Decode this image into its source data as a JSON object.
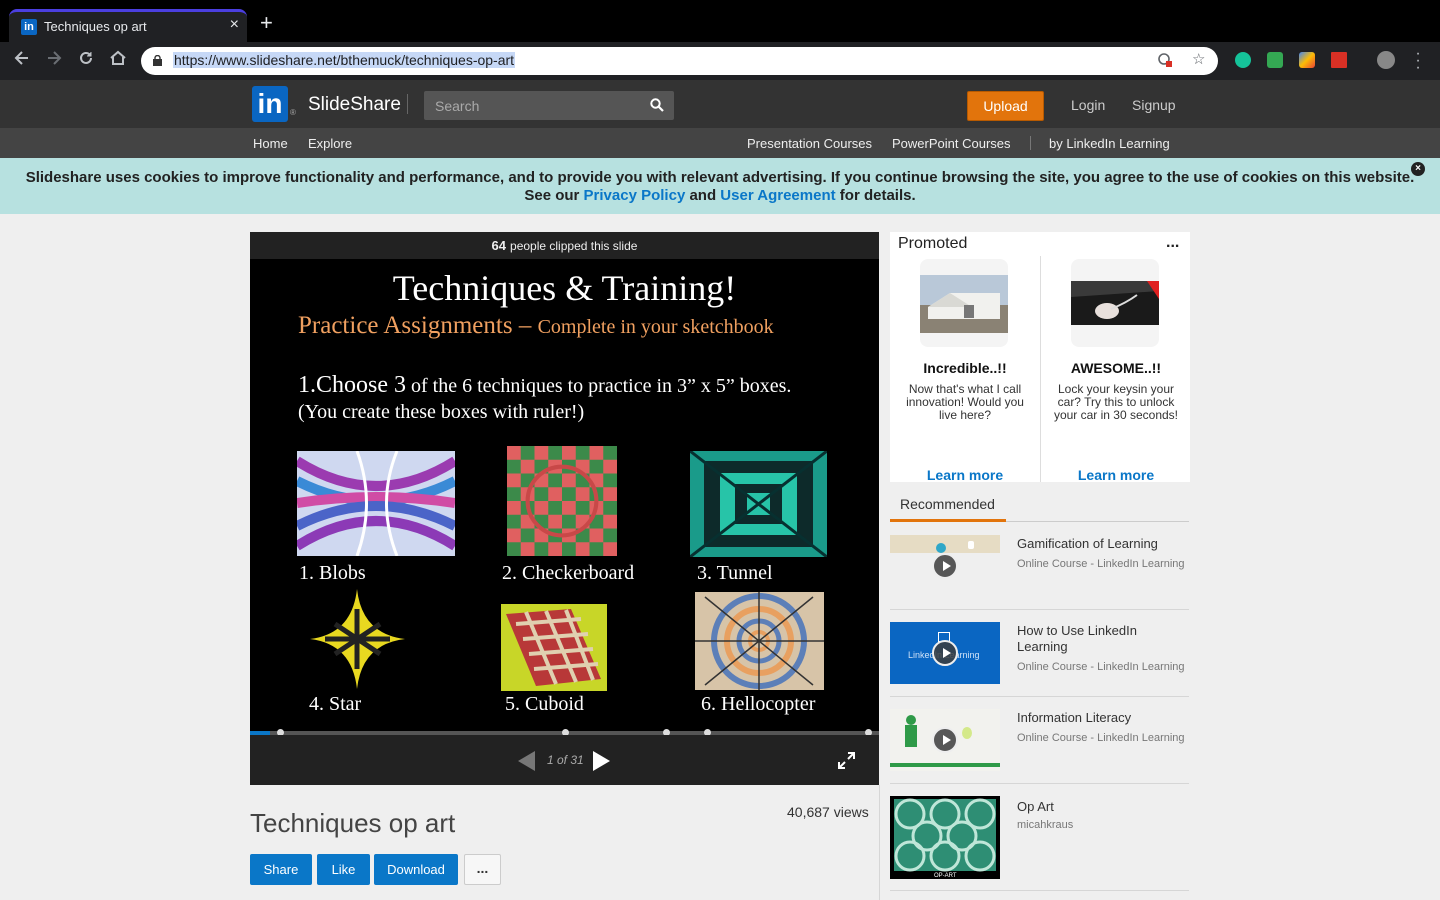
{
  "browser": {
    "tab_title": "Techniques op art",
    "tab_favicon": "in",
    "tab_close": "×",
    "new_tab": "+",
    "url": "https://www.slideshare.net/bthemuck/techniques-op-art"
  },
  "header": {
    "logo": "in",
    "logo_reg": "®",
    "brand": "SlideShare",
    "search_placeholder": "Search",
    "upload_label": "Upload",
    "login_label": "Login",
    "signup_label": "Signup"
  },
  "subnav": {
    "home": "Home",
    "explore": "Explore",
    "presentation_courses": "Presentation Courses",
    "powerpoint_courses": "PowerPoint Courses",
    "by_linkedin": "by LinkedIn Learning"
  },
  "cookie": {
    "line1": "Slideshare uses cookies to improve functionality and performance, and to provide you with relevant advertising. If you continue browsing the site, you agree to the use of cookies on this website.",
    "see_our": "See our",
    "privacy_policy": "Privacy Policy",
    "and": "and",
    "user_agreement": "User Agreement",
    "for_details": "for details.",
    "close": "×"
  },
  "player": {
    "clip_count": "64",
    "clip_text": "people clipped this slide",
    "page_indicator": "1 of 31",
    "progress_fraction": 0.032,
    "slide": {
      "title": "Techniques & Training!",
      "subtitle_main": "Practice Assignments",
      "subtitle_dash": " – ",
      "subtitle_rest": "Complete in your sketchbook",
      "instr_num": "1.Choose 3",
      "instr_rest": " of the 6 techniques to practice in 3” x 5” boxes.",
      "instr_line2": "(You create these boxes with ruler!)",
      "techniques": [
        "1.   Blobs",
        "2.  Checkerboard",
        "3. Tunnel",
        "4. Star",
        "5. Cuboid",
        "6. Hellocopter"
      ]
    }
  },
  "document": {
    "title": "Techniques op art",
    "views": "40,687 views",
    "share_label": "Share",
    "like_label": "Like",
    "download_label": "Download",
    "more_label": "..."
  },
  "promoted": {
    "label": "Promoted",
    "menu": "...",
    "cards": [
      {
        "title": "Incredible..!!",
        "text": "Now that's what I call innovation! Would you live here?",
        "link": "Learn more"
      },
      {
        "title": "AWESOME..!!",
        "text": "Lock your keysin your car? Try this to unlock your car in 30 seconds!",
        "link": "Learn more"
      }
    ]
  },
  "recommended": {
    "tab_label": "Recommended",
    "items": [
      {
        "title": "Gamification of Learning",
        "sub": "Online Course - LinkedIn Learning"
      },
      {
        "title": "How to Use LinkedIn Learning",
        "sub": "Online Course - LinkedIn Learning",
        "thumb_text": "LinkedIn Learning"
      },
      {
        "title": "Information Literacy",
        "sub": "Online Course - LinkedIn Learning"
      },
      {
        "title": "Op Art",
        "sub": "micahkraus",
        "thumb_text": "OP-ART"
      }
    ]
  },
  "colors": {
    "linkedin_blue": "#0a66c2",
    "upload_orange": "#e2740c",
    "cookie_bg": "#b7e1e0",
    "link_blue": "#0a77c8"
  }
}
